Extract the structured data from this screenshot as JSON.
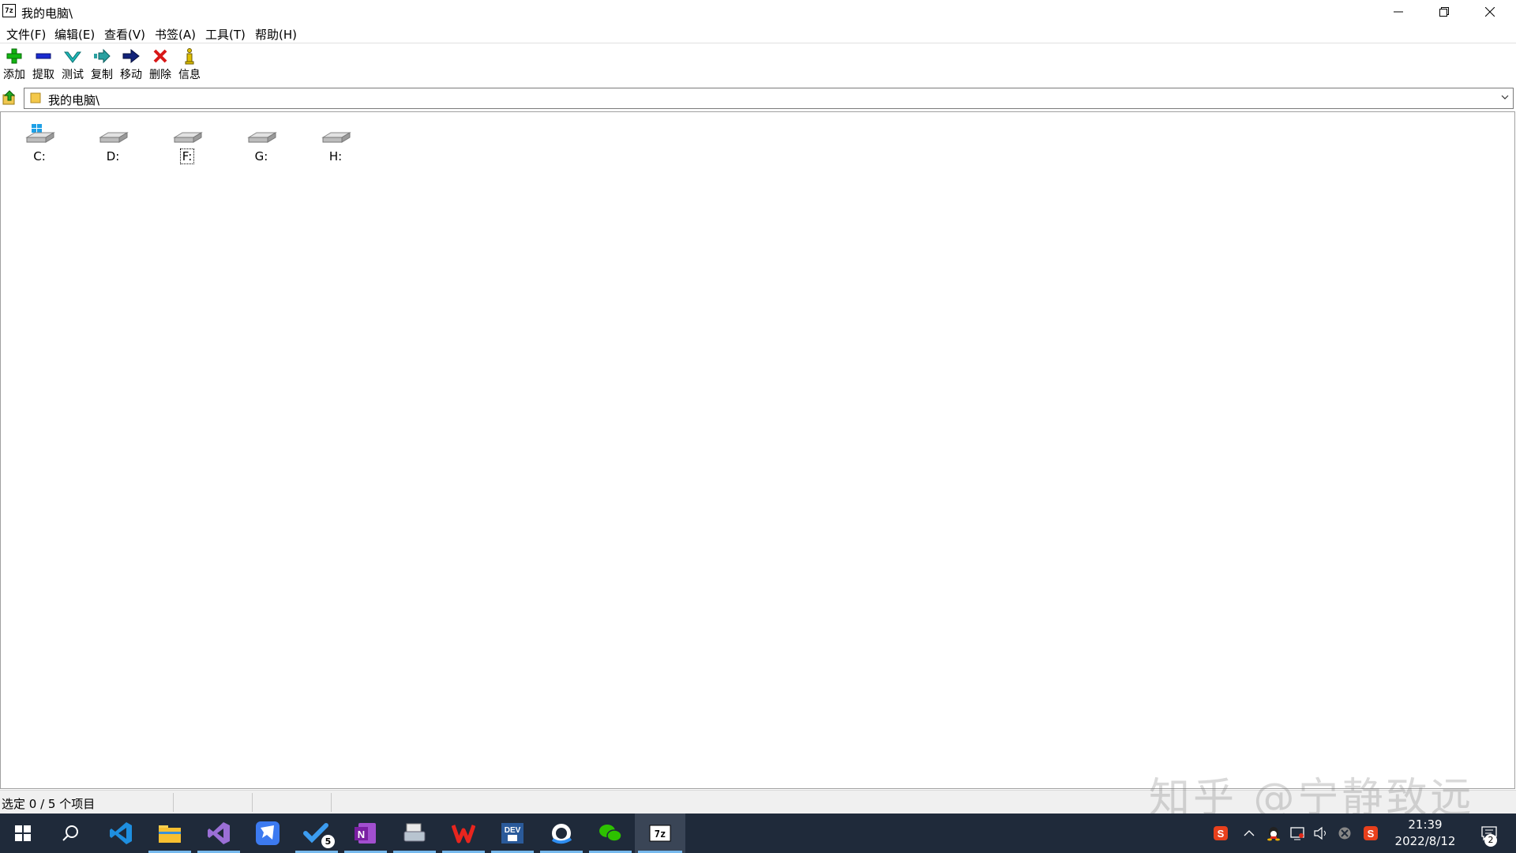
{
  "window": {
    "title": "我的电脑\\",
    "app_icon_text": "7z"
  },
  "menu": [
    "文件(F)",
    "编辑(E)",
    "查看(V)",
    "书签(A)",
    "工具(T)",
    "帮助(H)"
  ],
  "toolbar": [
    {
      "label": "添加",
      "icon": "add-icon"
    },
    {
      "label": "提取",
      "icon": "extract-icon"
    },
    {
      "label": "测试",
      "icon": "test-icon"
    },
    {
      "label": "复制",
      "icon": "copy-icon"
    },
    {
      "label": "移动",
      "icon": "move-icon"
    },
    {
      "label": "删除",
      "icon": "delete-icon"
    },
    {
      "label": "信息",
      "icon": "info-icon"
    }
  ],
  "address": {
    "path": "我的电脑\\"
  },
  "drives": [
    {
      "label": "C:",
      "icon": "windows-drive-icon"
    },
    {
      "label": "D:",
      "icon": "drive-icon"
    },
    {
      "label": "F:",
      "icon": "drive-icon",
      "focused": true
    },
    {
      "label": "G:",
      "icon": "drive-icon"
    },
    {
      "label": "H:",
      "icon": "drive-icon"
    }
  ],
  "status": {
    "text": "选定 0 / 5 个项目"
  },
  "watermark": "知乎 @宁静致远",
  "taskbar": {
    "apps": [
      "start-icon",
      "search-icon",
      "vscode-icon",
      "file-explorer-icon",
      "visual-studio-icon",
      "feishu-icon",
      "todo-icon",
      "onenote-icon",
      "scanner-icon",
      "wps-icon",
      "devexpress-icon",
      "qq-browser-icon",
      "wechat-icon",
      "7zip-icon"
    ],
    "todo_badge": "5",
    "time": "21:39",
    "date": "2022/8/12",
    "notification_count": "2"
  },
  "colors": {
    "taskbar": "#1f2a3a",
    "accent": "#76b9ed"
  }
}
